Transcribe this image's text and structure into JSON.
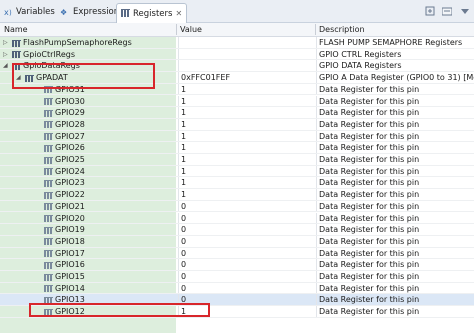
{
  "tabs": [
    {
      "label": "Variables",
      "icon": "variables-icon",
      "active": false
    },
    {
      "label": "Expressions",
      "icon": "expressions-icon",
      "active": false
    },
    {
      "label": "Registers",
      "icon": "registers-icon",
      "active": true
    }
  ],
  "columns": {
    "name": "Name",
    "value": "Value",
    "description": "Description"
  },
  "rows": [
    {
      "name": "FlashPumpSemaphoreRegs",
      "value": "",
      "desc": "FLASH PUMP SEMAPHORE Registers",
      "level": 0,
      "expander": "collapsed"
    },
    {
      "name": "GpioCtrlRegs",
      "value": "",
      "desc": "GPIO CTRL Registers",
      "level": 0,
      "expander": "collapsed"
    },
    {
      "name": "GpioDataRegs",
      "value": "",
      "desc": "GPIO DATA Registers",
      "level": 0,
      "expander": "expanded"
    },
    {
      "name": "GPADAT",
      "value": "0xFFC01FEF",
      "desc": "GPIO A Data Register (GPIO0 to 31) [Memo",
      "level": 1,
      "expander": "expanded"
    },
    {
      "name": "GPIO31",
      "value": "1",
      "desc": "Data Register for this pin",
      "level": 2
    },
    {
      "name": "GPIO30",
      "value": "1",
      "desc": "Data Register for this pin",
      "level": 2
    },
    {
      "name": "GPIO29",
      "value": "1",
      "desc": "Data Register for this pin",
      "level": 2
    },
    {
      "name": "GPIO28",
      "value": "1",
      "desc": "Data Register for this pin",
      "level": 2
    },
    {
      "name": "GPIO27",
      "value": "1",
      "desc": "Data Register for this pin",
      "level": 2
    },
    {
      "name": "GPIO26",
      "value": "1",
      "desc": "Data Register for this pin",
      "level": 2
    },
    {
      "name": "GPIO25",
      "value": "1",
      "desc": "Data Register for this pin",
      "level": 2
    },
    {
      "name": "GPIO24",
      "value": "1",
      "desc": "Data Register for this pin",
      "level": 2
    },
    {
      "name": "GPIO23",
      "value": "1",
      "desc": "Data Register for this pin",
      "level": 2
    },
    {
      "name": "GPIO22",
      "value": "1",
      "desc": "Data Register for this pin",
      "level": 2
    },
    {
      "name": "GPIO21",
      "value": "0",
      "desc": "Data Register for this pin",
      "level": 2
    },
    {
      "name": "GPIO20",
      "value": "0",
      "desc": "Data Register for this pin",
      "level": 2
    },
    {
      "name": "GPIO19",
      "value": "0",
      "desc": "Data Register for this pin",
      "level": 2
    },
    {
      "name": "GPIO18",
      "value": "0",
      "desc": "Data Register for this pin",
      "level": 2
    },
    {
      "name": "GPIO17",
      "value": "0",
      "desc": "Data Register for this pin",
      "level": 2
    },
    {
      "name": "GPIO16",
      "value": "0",
      "desc": "Data Register for this pin",
      "level": 2
    },
    {
      "name": "GPIO15",
      "value": "0",
      "desc": "Data Register for this pin",
      "level": 2
    },
    {
      "name": "GPIO14",
      "value": "0",
      "desc": "Data Register for this pin",
      "level": 2
    },
    {
      "name": "GPIO13",
      "value": "0",
      "desc": "Data Register for this pin",
      "level": 2,
      "selected": true
    },
    {
      "name": "GPIO12",
      "value": "1",
      "desc": "Data Register for this pin",
      "level": 2
    }
  ],
  "colors": {
    "tree_bg": "#ddeedd",
    "highlight": "#d8262b",
    "selected_row": "#dbe7f6"
  }
}
